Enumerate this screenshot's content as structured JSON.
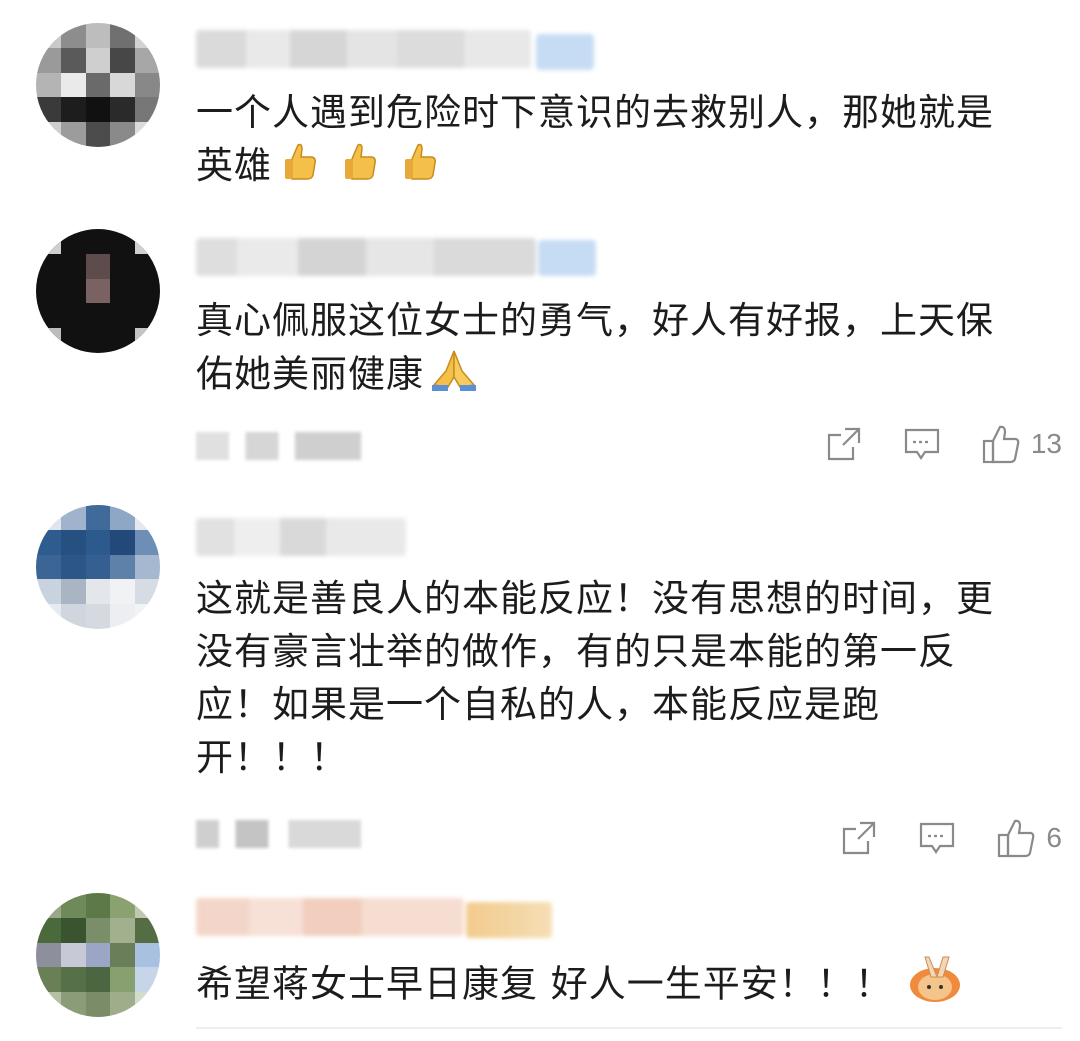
{
  "comments": [
    {
      "text_line1": "一个人遇到危险时下意识的去救别人，那她就是",
      "text_line2": "英雄",
      "emoji_icon": "thumbs-up-icon"
    },
    {
      "text_line1": "真心佩服这位女士的勇气，好人有好报，上天保",
      "text_line2": "佑她美丽健康",
      "emoji_icon": "folded-hands-icon",
      "like_count": "13"
    },
    {
      "text_line1": "这就是善良人的本能反应！没有思想的时间，更",
      "text_line2": "没有豪言壮举的做作，有的只是本能的第一反",
      "text_line3": "应！如果是一个自私的人，本能反应是跑",
      "text_line4": "开！！！",
      "like_count": "6"
    },
    {
      "text_line1": "希望蒋女士早日康复 好人一生平安！！！",
      "emoji_icon": "victory-hand-icon"
    }
  ],
  "colors": {
    "text": "#1c1c1c",
    "meta_gray": "#8a8a8a",
    "emoji_yellow": "#f5c04a",
    "vip_blue": "#9ec3ee"
  }
}
